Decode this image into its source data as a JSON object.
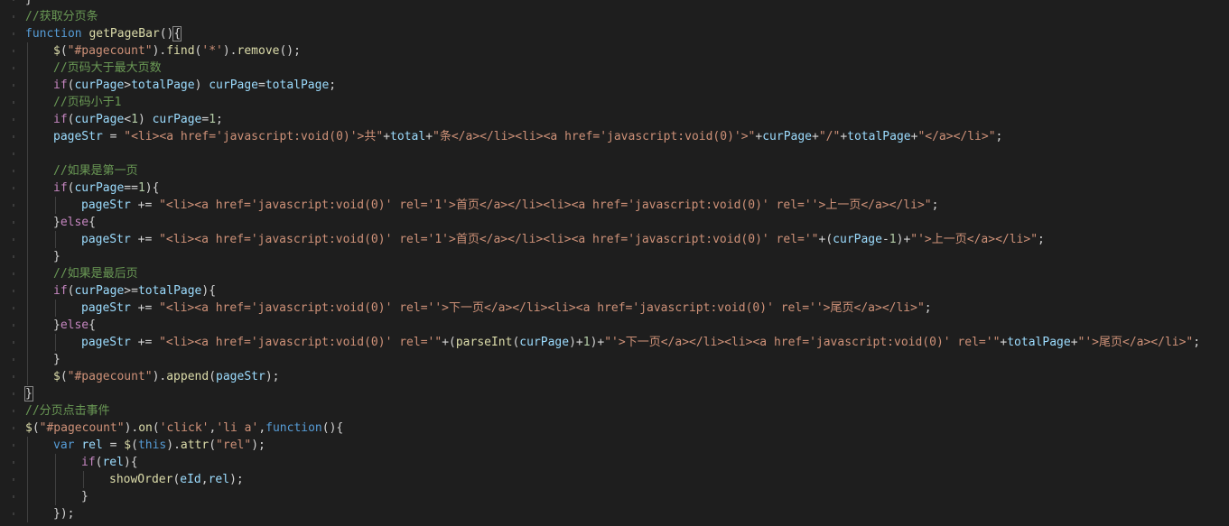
{
  "editor": {
    "language": "javascript",
    "colors": {
      "background": "#1e1e1e",
      "default": "#d4d4d4",
      "keyword": "#569cd6",
      "function": "#dcdcaa",
      "string": "#ce9178",
      "comment": "#6a9955",
      "number": "#b5cea8",
      "variable": "#9cdcfe",
      "control": "#c586c0",
      "indent_guide": "#404040"
    },
    "lines": [
      {
        "indent": 0,
        "tokens": [
          [
            "punc",
            "}"
          ]
        ]
      },
      {
        "indent": 0,
        "tokens": [
          [
            "cm",
            "//获取分页条"
          ]
        ]
      },
      {
        "indent": 0,
        "tokens": [
          [
            "kw",
            "function"
          ],
          [
            "punc",
            " "
          ],
          [
            "fn",
            "getPageBar"
          ],
          [
            "punc",
            "()"
          ],
          [
            "brace",
            "{"
          ]
        ]
      },
      {
        "indent": 1,
        "tokens": [
          [
            "fn",
            "$"
          ],
          [
            "punc",
            "("
          ],
          [
            "str",
            "\"#pagecount\""
          ],
          [
            "punc",
            ")."
          ],
          [
            "fn",
            "find"
          ],
          [
            "punc",
            "("
          ],
          [
            "str",
            "'*'"
          ],
          [
            "punc",
            ")."
          ],
          [
            "fn",
            "remove"
          ],
          [
            "punc",
            "();"
          ]
        ]
      },
      {
        "indent": 1,
        "tokens": [
          [
            "cm",
            "//页码大于最大页数"
          ]
        ]
      },
      {
        "indent": 1,
        "tokens": [
          [
            "ctl",
            "if"
          ],
          [
            "punc",
            "("
          ],
          [
            "var",
            "curPage"
          ],
          [
            "punc",
            ">"
          ],
          [
            "var",
            "totalPage"
          ],
          [
            "punc",
            ") "
          ],
          [
            "var",
            "curPage"
          ],
          [
            "punc",
            "="
          ],
          [
            "var",
            "totalPage"
          ],
          [
            "punc",
            ";"
          ]
        ]
      },
      {
        "indent": 1,
        "tokens": [
          [
            "cm",
            "//页码小于1"
          ]
        ]
      },
      {
        "indent": 1,
        "tokens": [
          [
            "ctl",
            "if"
          ],
          [
            "punc",
            "("
          ],
          [
            "var",
            "curPage"
          ],
          [
            "punc",
            "<"
          ],
          [
            "num",
            "1"
          ],
          [
            "punc",
            ") "
          ],
          [
            "var",
            "curPage"
          ],
          [
            "punc",
            "="
          ],
          [
            "num",
            "1"
          ],
          [
            "punc",
            ";"
          ]
        ]
      },
      {
        "indent": 1,
        "tokens": [
          [
            "var",
            "pageStr"
          ],
          [
            "punc",
            " = "
          ],
          [
            "str",
            "\"<li><a href='javascript:void(0)'>共\""
          ],
          [
            "punc",
            "+"
          ],
          [
            "var",
            "total"
          ],
          [
            "punc",
            "+"
          ],
          [
            "str",
            "\"条</a></li><li><a href='javascript:void(0)'>\""
          ],
          [
            "punc",
            "+"
          ],
          [
            "var",
            "curPage"
          ],
          [
            "punc",
            "+"
          ],
          [
            "str",
            "\"/\""
          ],
          [
            "punc",
            "+"
          ],
          [
            "var",
            "totalPage"
          ],
          [
            "punc",
            "+"
          ],
          [
            "str",
            "\"</a></li>\""
          ],
          [
            "punc",
            ";"
          ]
        ]
      },
      {
        "indent": 1,
        "tokens": []
      },
      {
        "indent": 1,
        "tokens": [
          [
            "cm",
            "//如果是第一页"
          ]
        ]
      },
      {
        "indent": 1,
        "tokens": [
          [
            "ctl",
            "if"
          ],
          [
            "punc",
            "("
          ],
          [
            "var",
            "curPage"
          ],
          [
            "punc",
            "=="
          ],
          [
            "num",
            "1"
          ],
          [
            "punc",
            "){"
          ]
        ]
      },
      {
        "indent": 2,
        "tokens": [
          [
            "var",
            "pageStr"
          ],
          [
            "punc",
            " += "
          ],
          [
            "str",
            "\"<li><a href='javascript:void(0)' rel='1'>首页</a></li><li><a href='javascript:void(0)' rel=''>上一页</a></li>\""
          ],
          [
            "punc",
            ";"
          ]
        ]
      },
      {
        "indent": 1,
        "tokens": [
          [
            "punc",
            "}"
          ],
          [
            "ctl",
            "else"
          ],
          [
            "punc",
            "{"
          ]
        ]
      },
      {
        "indent": 2,
        "tokens": [
          [
            "var",
            "pageStr"
          ],
          [
            "punc",
            " += "
          ],
          [
            "str",
            "\"<li><a href='javascript:void(0)' rel='1'>首页</a></li><li><a href='javascript:void(0)' rel='\""
          ],
          [
            "punc",
            "+("
          ],
          [
            "var",
            "curPage"
          ],
          [
            "punc",
            "-"
          ],
          [
            "num",
            "1"
          ],
          [
            "punc",
            ")+"
          ],
          [
            "str",
            "\"'>上一页</a></li>\""
          ],
          [
            "punc",
            ";"
          ]
        ]
      },
      {
        "indent": 1,
        "tokens": [
          [
            "punc",
            "}"
          ]
        ]
      },
      {
        "indent": 1,
        "tokens": [
          [
            "cm",
            "//如果是最后页"
          ]
        ]
      },
      {
        "indent": 1,
        "tokens": [
          [
            "ctl",
            "if"
          ],
          [
            "punc",
            "("
          ],
          [
            "var",
            "curPage"
          ],
          [
            "punc",
            ">="
          ],
          [
            "var",
            "totalPage"
          ],
          [
            "punc",
            "){"
          ]
        ]
      },
      {
        "indent": 2,
        "tokens": [
          [
            "var",
            "pageStr"
          ],
          [
            "punc",
            " += "
          ],
          [
            "str",
            "\"<li><a href='javascript:void(0)' rel=''>下一页</a></li><li><a href='javascript:void(0)' rel=''>尾页</a></li>\""
          ],
          [
            "punc",
            ";"
          ]
        ]
      },
      {
        "indent": 1,
        "tokens": [
          [
            "punc",
            "}"
          ],
          [
            "ctl",
            "else"
          ],
          [
            "punc",
            "{"
          ]
        ]
      },
      {
        "indent": 2,
        "tokens": [
          [
            "var",
            "pageStr"
          ],
          [
            "punc",
            " += "
          ],
          [
            "str",
            "\"<li><a href='javascript:void(0)' rel='\""
          ],
          [
            "punc",
            "+("
          ],
          [
            "fn",
            "parseInt"
          ],
          [
            "punc",
            "("
          ],
          [
            "var",
            "curPage"
          ],
          [
            "punc",
            ")+"
          ],
          [
            "num",
            "1"
          ],
          [
            "punc",
            ")+"
          ],
          [
            "str",
            "\"'>下一页</a></li><li><a href='javascript:void(0)' rel='\""
          ],
          [
            "punc",
            "+"
          ],
          [
            "var",
            "totalPage"
          ],
          [
            "punc",
            "+"
          ],
          [
            "str",
            "\"'>尾页</a></li>\""
          ],
          [
            "punc",
            ";"
          ]
        ]
      },
      {
        "indent": 1,
        "tokens": [
          [
            "punc",
            "}"
          ]
        ]
      },
      {
        "indent": 1,
        "tokens": [
          [
            "fn",
            "$"
          ],
          [
            "punc",
            "("
          ],
          [
            "str",
            "\"#pagecount\""
          ],
          [
            "punc",
            ")."
          ],
          [
            "fn",
            "append"
          ],
          [
            "punc",
            "("
          ],
          [
            "var",
            "pageStr"
          ],
          [
            "punc",
            ");"
          ]
        ]
      },
      {
        "indent": 0,
        "tokens": [
          [
            "brace",
            "}"
          ]
        ]
      },
      {
        "indent": 0,
        "tokens": [
          [
            "cm",
            "//分页点击事件"
          ]
        ]
      },
      {
        "indent": 0,
        "tokens": [
          [
            "fn",
            "$"
          ],
          [
            "punc",
            "("
          ],
          [
            "str",
            "\"#pagecount\""
          ],
          [
            "punc",
            ")."
          ],
          [
            "fn",
            "on"
          ],
          [
            "punc",
            "("
          ],
          [
            "str",
            "'click'"
          ],
          [
            "punc",
            ","
          ],
          [
            "str",
            "'li a'"
          ],
          [
            "punc",
            ","
          ],
          [
            "kw",
            "function"
          ],
          [
            "punc",
            "(){"
          ]
        ]
      },
      {
        "indent": 1,
        "tokens": [
          [
            "kw",
            "var"
          ],
          [
            "punc",
            " "
          ],
          [
            "var",
            "rel"
          ],
          [
            "punc",
            " = "
          ],
          [
            "fn",
            "$"
          ],
          [
            "punc",
            "("
          ],
          [
            "kw",
            "this"
          ],
          [
            "punc",
            ")."
          ],
          [
            "fn",
            "attr"
          ],
          [
            "punc",
            "("
          ],
          [
            "str",
            "\"rel\""
          ],
          [
            "punc",
            ");"
          ]
        ]
      },
      {
        "indent": 2,
        "tokens": [
          [
            "ctl",
            "if"
          ],
          [
            "punc",
            "("
          ],
          [
            "var",
            "rel"
          ],
          [
            "punc",
            "){"
          ]
        ]
      },
      {
        "indent": 3,
        "tokens": [
          [
            "fn",
            "showOrder"
          ],
          [
            "punc",
            "("
          ],
          [
            "var",
            "eId"
          ],
          [
            "punc",
            ","
          ],
          [
            "var",
            "rel"
          ],
          [
            "punc",
            ");"
          ]
        ]
      },
      {
        "indent": 2,
        "tokens": [
          [
            "punc",
            "}"
          ]
        ]
      },
      {
        "indent": 1,
        "tokens": [
          [
            "punc",
            "});"
          ]
        ]
      }
    ]
  }
}
